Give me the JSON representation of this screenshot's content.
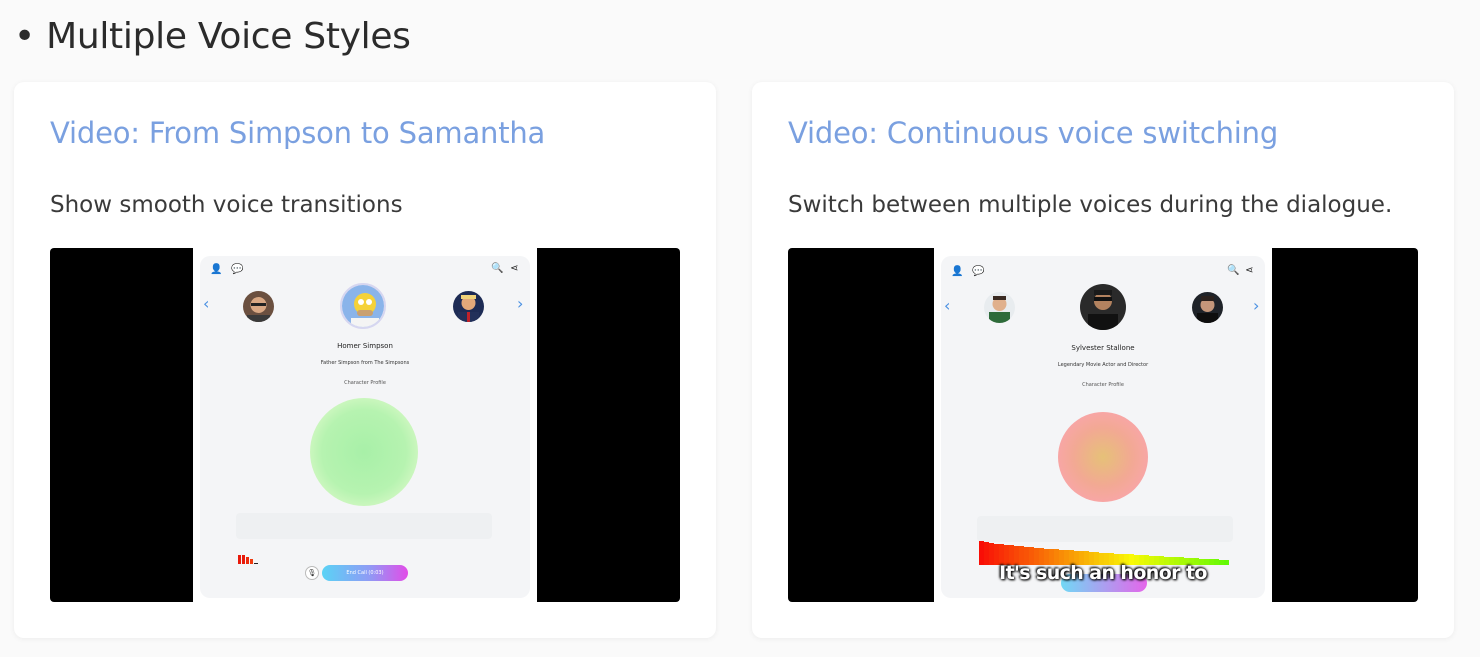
{
  "section": {
    "heading": "• Multiple Voice Styles"
  },
  "cards": [
    {
      "title": "Video: From Simpson to Samantha",
      "description": "Show smooth voice transitions",
      "app": {
        "toolbar_icons": [
          "add-user-icon",
          "chat-icon",
          "search-icon",
          "share-icon"
        ],
        "character_name": "Homer Simpson",
        "character_subtitle": "Father Simpson from The Simpsons",
        "profile_link": "Character Profile",
        "end_call_label": "End Call (0:03)",
        "orb_color": "#a8f0a8"
      }
    },
    {
      "title": "Video: Continuous voice switching",
      "description": "Switch between multiple voices during the dialogue.",
      "app": {
        "toolbar_icons": [
          "add-user-icon",
          "chat-icon",
          "search-icon",
          "share-icon"
        ],
        "character_name": "Sylvester Stallone",
        "character_subtitle": "Legendary Movie Actor and Director",
        "profile_link": "Character Profile",
        "caption": "It's such an honor to",
        "orb_color": "#f2a993"
      }
    }
  ],
  "colors": {
    "title_accent": "#7aa0e0",
    "arrow_accent": "#4a90e2"
  }
}
